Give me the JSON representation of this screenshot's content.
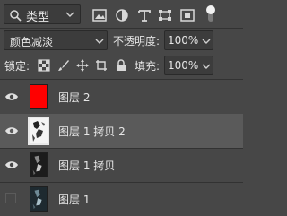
{
  "filter": {
    "kind_label": "类型",
    "icons": [
      "image-filter-icon",
      "adjustment-filter-icon",
      "text-filter-icon",
      "shape-filter-icon",
      "smart-object-filter-icon"
    ]
  },
  "blend": {
    "mode": "颜色减淡",
    "opacity_label": "不透明度:",
    "opacity_value": "100%"
  },
  "lock": {
    "label": "锁定:",
    "fill_label": "填充:",
    "fill_value": "100%",
    "icons": [
      "lock-transparent-pixels-icon",
      "lock-image-pixels-icon",
      "lock-position-icon",
      "lock-artboard-icon",
      "lock-all-icon"
    ]
  },
  "layers": [
    {
      "name": "图层 2",
      "visible": true,
      "selected": false,
      "thumb": "red"
    },
    {
      "name": "图层 1 拷贝 2",
      "visible": true,
      "selected": true,
      "thumb": "sketch"
    },
    {
      "name": "图层 1 拷贝",
      "visible": true,
      "selected": false,
      "thumb": "dark"
    },
    {
      "name": "图层 1",
      "visible": false,
      "selected": false,
      "thumb": "dark"
    }
  ],
  "colors": {
    "panel_bg": "#474747",
    "selected_bg": "#5a5a5a",
    "red_fill": "#ff0000",
    "text": "#e6e6e6"
  }
}
